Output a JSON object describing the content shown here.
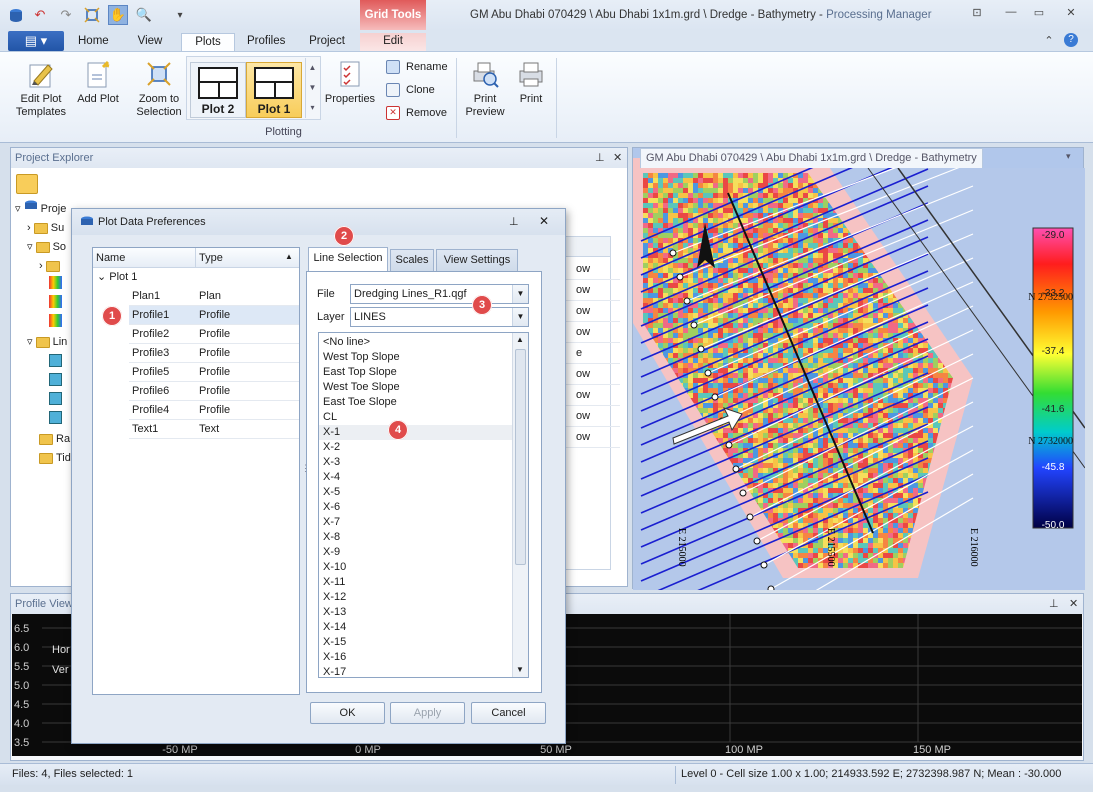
{
  "window": {
    "title_main": "GM Abu Dhabi 070429 \\ Abu Dhabi 1x1m.grd \\ Dredge - Bathymetry",
    "title_sep": " - ",
    "title_app": "Processing Manager",
    "context_tab": "Grid Tools"
  },
  "ribbon": {
    "tabs": [
      "Home",
      "View",
      "Plots",
      "Profiles",
      "Project",
      "Edit"
    ],
    "buttons": {
      "edit_plot_templates": "Edit Plot\nTemplates",
      "add_plot": "Add Plot",
      "zoom_to_selection": "Zoom to\nSelection",
      "plot2": "Plot 2",
      "plot1": "Plot 1",
      "properties": "Properties",
      "rename": "Rename",
      "clone": "Clone",
      "remove": "Remove",
      "print_preview": "Print\nPreview",
      "print": "Print"
    },
    "group_label": "Plotting"
  },
  "project_explorer": {
    "title": "Project Explorer",
    "tree": [
      "Proje",
      "Su",
      "So",
      "Lin",
      "Ra",
      "Tid"
    ],
    "right_col_header": "l",
    "right_col_values": [
      "ow",
      "ow",
      "ow",
      "ow",
      "e",
      "ow",
      "ow",
      "ow",
      "ow"
    ]
  },
  "map": {
    "tab": "GM Abu Dhabi 070429 \\ Abu Dhabi 1x1m.grd \\ Dredge - Bathymetry",
    "legend_values": [
      "-29.0",
      "-33.2",
      "-37.4",
      "-41.6",
      "-45.8",
      "-50.0"
    ],
    "north_labels": [
      "N 2732500",
      "N 2732000"
    ],
    "east_labels": [
      "E 215000",
      "E 215500",
      "E 216000"
    ]
  },
  "profile_view": {
    "title": "Profile View",
    "y_ticks": [
      "6.5",
      "6.0",
      "5.5",
      "5.0",
      "4.5",
      "4.0",
      "3.5"
    ],
    "x_ticks": [
      "-50 MP",
      "0 MP",
      "50 MP",
      "100 MP",
      "150 MP"
    ],
    "labels": [
      "Hor",
      "Ver"
    ]
  },
  "status": {
    "left": "Files: 4, Files selected: 1",
    "right": "Level 0 - Cell size 1.00 x 1.00; 214933.592 E; 2732398.987 N; Mean : -30.000"
  },
  "dialog": {
    "title": "Plot Data Preferences",
    "columns": [
      "Name",
      "Type"
    ],
    "group": "Plot 1",
    "rows": [
      {
        "name": "Plan1",
        "type": "Plan"
      },
      {
        "name": "Profile1",
        "type": "Profile"
      },
      {
        "name": "Profile2",
        "type": "Profile"
      },
      {
        "name": "Profile3",
        "type": "Profile"
      },
      {
        "name": "Profile5",
        "type": "Profile"
      },
      {
        "name": "Profile6",
        "type": "Profile"
      },
      {
        "name": "Profile4",
        "type": "Profile"
      },
      {
        "name": "Text1",
        "type": "Text"
      }
    ],
    "tabs": [
      "Line Selection",
      "Scales",
      "View Settings"
    ],
    "file_label": "File",
    "file_value": "Dredging Lines_R1.qgf",
    "layer_label": "Layer",
    "layer_value": "LINES",
    "lines": [
      "<No line>",
      "West Top Slope",
      "East Top Slope",
      "West Toe Slope",
      "East Toe Slope",
      "CL",
      "X-1",
      "X-2",
      "X-3",
      "X-4",
      "X-5",
      "X-6",
      "X-7",
      "X-8",
      "X-9",
      "X-10",
      "X-11",
      "X-12",
      "X-13",
      "X-14",
      "X-15",
      "X-16",
      "X-17"
    ],
    "buttons": {
      "ok": "OK",
      "apply": "Apply",
      "cancel": "Cancel"
    },
    "badges": [
      "1",
      "2",
      "3",
      "4"
    ]
  }
}
